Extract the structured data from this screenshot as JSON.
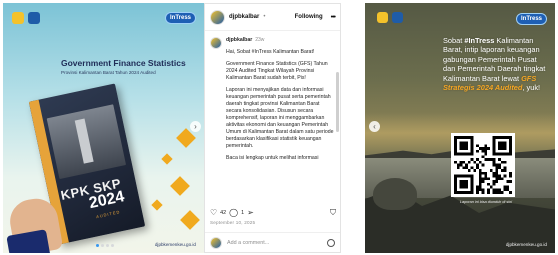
{
  "left_post": {
    "badge": "InTress",
    "title": "Government Finance Statistics",
    "subtitle": "Provinsi Kalimantan Barat Tahun 2024 Audited",
    "book_text": "KPK SKP",
    "book_year": "2024",
    "book_audited": "AUDITED",
    "website": "djpbkemenkeu.go.id",
    "next_icon": "›"
  },
  "instagram": {
    "username": "djpbkalbar",
    "follow_label": "Following",
    "more_icon": "•••",
    "caption_user": "djpbkalbar",
    "caption_time": "23w",
    "caption_p1": "Hai, Sobat #InTress Kalimantan Barat!",
    "caption_p2": "Government Finance Statistics (GFS) Tahun 2024 Audited Tingkat Wilayah Provinsi Kalimantan Barat sudah terbit, Pis!",
    "caption_p3": "Laporan ini menyajikan data dan informasi keuangan pemerintah pusat serta pemerintah daerah tingkat provinsi Kalimantan Barat secara konsolidasian. Disusun secara komprehensif, laporan ini menggambarkan aktivitas ekonomi dan keuangan Pemerintah Umum di Kalimantan Barat dalam satu periode berdasarkan klasifikasi statistik keuangan pemerintah.",
    "caption_p4": "Baca isi lengkap untuk melihat informasi",
    "likes": "42",
    "comments": "1",
    "date": "September 10, 2025",
    "comment_placeholder": "Add a comment..."
  },
  "right_post": {
    "badge": "InTress",
    "text_pre": "Sobat ",
    "text_hash": "#InTress",
    "text_mid": " Kalimantan Barat, intip laporan keuangan gabungan Pemerintah Pusat dan Pemerintah Daerah tingkat Kalimantan Barat lewat ",
    "text_gfs": "GFS Strategis 2024 Audited",
    "text_end": ", yuk!",
    "qr_caption": "Laporan ini bisa diunduh di sini",
    "website": "djpbkemenkeu.go.id",
    "prev_icon": "‹"
  },
  "colors": {
    "brand_blue": "#1e5fb4",
    "accent_orange": "#f0a91e",
    "ig_link": "#00376b"
  }
}
